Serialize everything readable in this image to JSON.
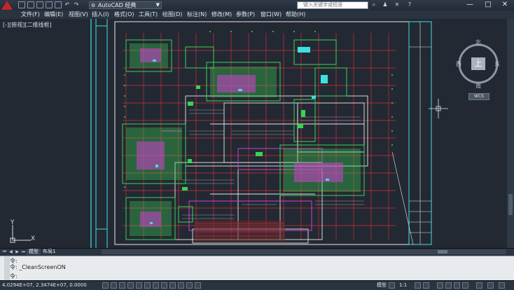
{
  "titlebar": {
    "workspace": "AutoCAD 经典",
    "search_placeholder": "键入关键字或短语",
    "user_icon": "user-icon",
    "help_icon": "help-icon",
    "window_controls": [
      "—",
      "□",
      "✕"
    ]
  },
  "menubar": {
    "items": [
      "文件(F)",
      "编辑(E)",
      "视图(V)",
      "插入(I)",
      "格式(O)",
      "工具(T)",
      "绘图(D)",
      "标注(N)",
      "修改(M)",
      "参数(P)",
      "窗口(W)",
      "帮助(H)"
    ]
  },
  "viewport": {
    "label": "[-][俯视][二维线框]",
    "viewcube": {
      "north": "北",
      "south": "南",
      "east": "东",
      "west": "西",
      "face": "上"
    },
    "wcs": "WCS",
    "ucs": {
      "x": "X",
      "y": "Y"
    }
  },
  "layout_tabs": [
    "模型",
    "布局1"
  ],
  "command_line": {
    "history": [
      "命令:",
      "命令: _CleanScreenON"
    ],
    "prompt": "命令:"
  },
  "statusbar": {
    "coords": "4.0294E+07, 2.3474E+07, 0.0000",
    "model_label": "模型",
    "scale": "1:1"
  },
  "colors": {
    "canvas_bg": "#222933",
    "accent": "#c8232b",
    "cad_green": "#39d353",
    "cad_red": "#e0303a",
    "cad_magenta": "#d040d0",
    "cad_cyan": "#40e0e0",
    "cad_white": "#e8e8e8"
  }
}
